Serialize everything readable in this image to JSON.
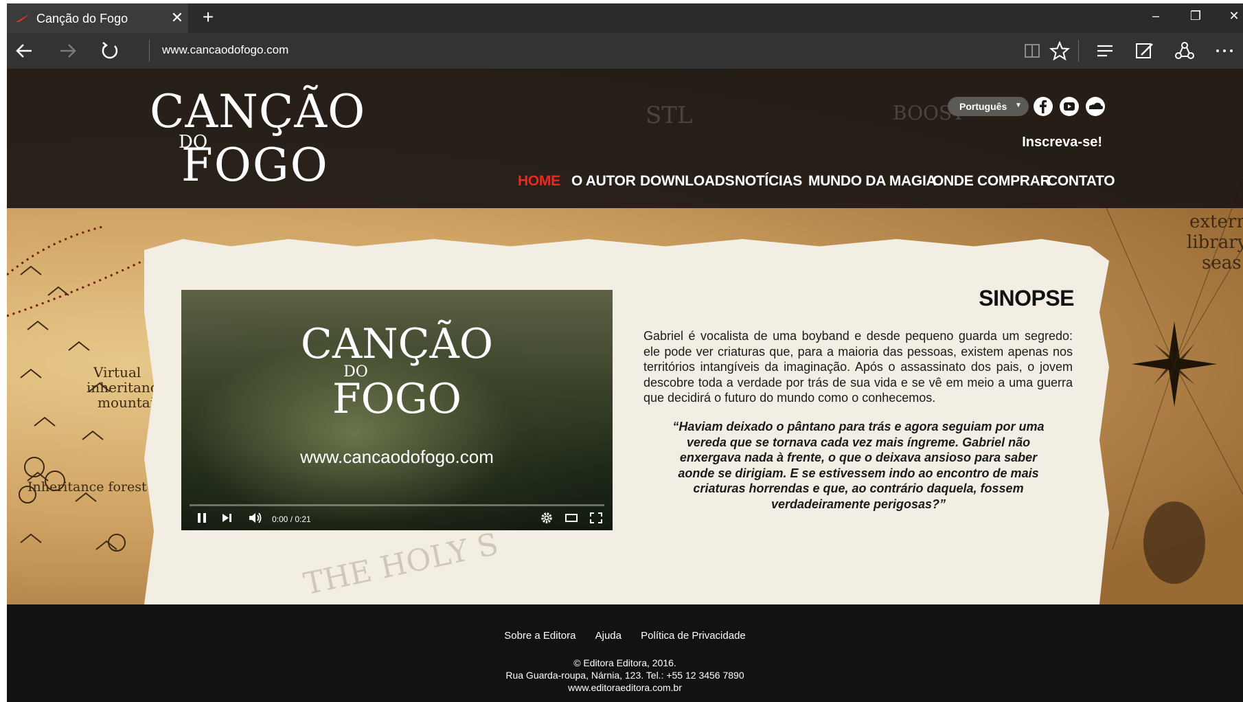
{
  "browser": {
    "tab_title": "Canção do Fogo",
    "address": "www.cancaodofogo.com"
  },
  "header": {
    "logo": {
      "line1": "CANÇÃO",
      "line2": "DO",
      "line3": "FOGO"
    },
    "language": "Português",
    "subscribe": "Inscreva-se!",
    "menu": [
      {
        "label": "HOME",
        "active": true
      },
      {
        "label": "O AUTOR"
      },
      {
        "label": "DOWNLOADS"
      },
      {
        "label": "NOTÍCIAS"
      },
      {
        "label": "MUNDO DA MAGIA"
      },
      {
        "label": "ONDE COMPRAR"
      },
      {
        "label": "CONTATO"
      }
    ]
  },
  "video": {
    "logo": {
      "line1": "CANÇÃO",
      "line2": "DO",
      "line3": "FOGO"
    },
    "url": "www.cancaodofogo.com",
    "time": "0:00 / 0:21"
  },
  "synopsis": {
    "title": "SINOPSE",
    "body": "Gabriel é vocalista de uma boyband e desde pequeno guarda um segredo: ele pode ver criaturas que, para a maioria das pessoas, existem apenas nos territórios intangíveis da imaginação. Após o assassinato dos pais, o jovem descobre toda a verdade por trás de sua vida e se vê em meio a uma guerra que decidirá o futuro do mundo como o conhecemos.",
    "quote": "“Haviam deixado o pântano para trás e agora seguiam por uma vereda que se tornava cada vez mais íngreme. Gabriel não enxergava nada à frente, o que o deixava ansioso para saber aonde se dirigiam. E se estivessem indo ao encontro de mais criaturas horrendas e que, ao contrário daquela, fossem verdadeiramente perigosas?”"
  },
  "map_labels": {
    "virtual": "Virtual",
    "inheritance": "inheritance",
    "mountains": "mountains",
    "forest": "Inheritance forest",
    "extern": "extern",
    "library": "library",
    "seas": "seas",
    "holy": "THE HOLY S",
    "stl": "STL",
    "boost": "BOOST"
  },
  "footer": {
    "links": [
      "Sobre a Editora",
      "Ajuda",
      "Política de Privacidade"
    ],
    "copyright": "© Editora Editora, 2016.",
    "address": "Rua Guarda-roupa, Nárnia, 123. Tel.: +55 12 3456 7890",
    "site": "www.editoraeditora.com.br"
  },
  "colors": {
    "accent": "#e52b22",
    "header_bg": "#1c1814",
    "footer_bg": "#121212"
  }
}
